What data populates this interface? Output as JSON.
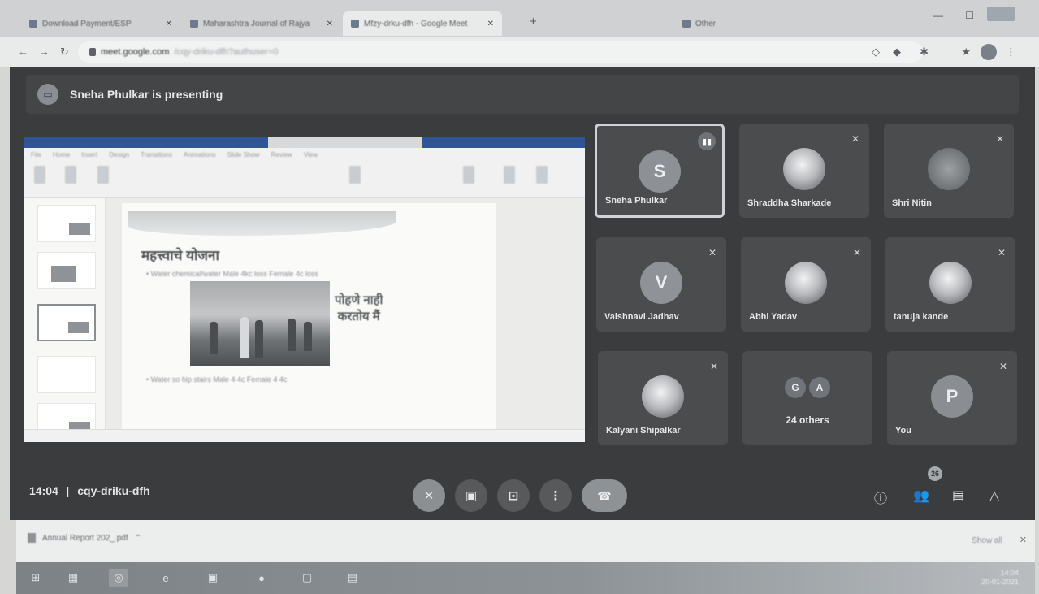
{
  "browser": {
    "tabs": [
      {
        "label": "Download Payment/ESP"
      },
      {
        "label": "Maharashtra Journal of Rajya"
      },
      {
        "label": "Mfzy-drku-dfh - Google Meet"
      },
      {
        "label": "Other"
      }
    ],
    "url": "meet.google.com",
    "url_path": "/cqy-driku-dfh?authuser=0"
  },
  "meet": {
    "presenting_text": "Sneha Phulkar is presenting",
    "slide": {
      "heading": "महत्त्वाचे योजना",
      "bullet_top": "• Water chemical/water   Male 4kc loss     Female 4c loss",
      "bullet_bottom": "• Water so hip stairs   Male 4 4c           Female 4 4c",
      "photo_caption_1": "पोहणे नाही",
      "photo_caption_2": "करतोय मैं"
    },
    "participants": [
      {
        "name": "Sneha Phulkar",
        "initial": "S",
        "avatar_color": "#8d9094"
      },
      {
        "name": "Shraddha Sharkade",
        "initial": "",
        "avatar_color": ""
      },
      {
        "name": "Shri Nitin",
        "initial": "",
        "avatar_color": ""
      },
      {
        "name": "Vaishnavi Jadhav",
        "initial": "V",
        "avatar_color": "#8f9296"
      },
      {
        "name": "Abhi Yadav",
        "initial": "",
        "avatar_color": ""
      },
      {
        "name": "tanuja kande",
        "initial": "",
        "avatar_color": ""
      },
      {
        "name": "Kalyani Shipalkar",
        "initial": "",
        "avatar_color": ""
      },
      {
        "name": "24 others",
        "initial": "",
        "avatar_color": ""
      },
      {
        "name": "You",
        "initial": "P",
        "avatar_color": "#8a8d91"
      }
    ],
    "others_initials": [
      "G",
      "A"
    ],
    "time": "14:04",
    "meeting_code": "cqy-driku-dfh",
    "participants_count": "26",
    "icons": {
      "mic": "mic-off-icon",
      "camera": "camera-icon",
      "present": "present-screen-icon",
      "more": "more-options-icon",
      "hangup": "hangup-icon",
      "info": "info-icon",
      "people": "people-icon",
      "chat": "chat-icon",
      "activities": "activities-icon"
    }
  },
  "downloads": {
    "file": "Annual Report 202_.pdf",
    "show_all": "Show all"
  },
  "taskbar": {
    "time": "14:04",
    "date": "20-01-2021"
  }
}
